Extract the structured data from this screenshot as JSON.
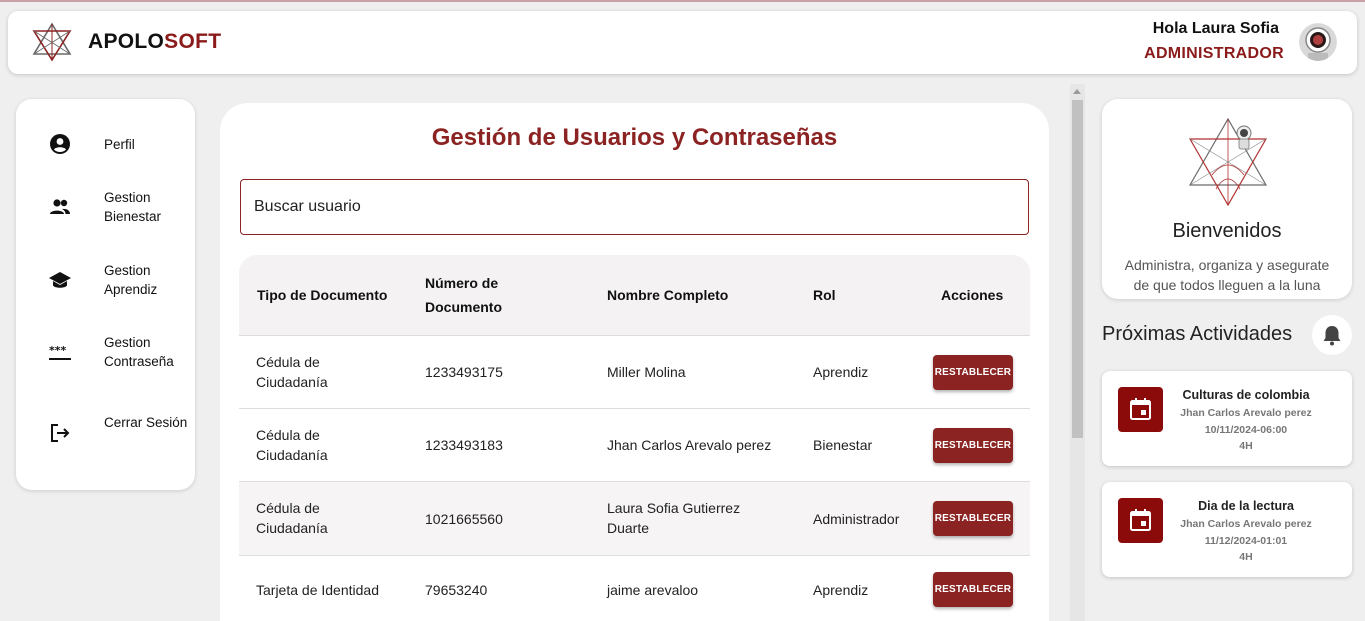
{
  "header": {
    "brand_part1": "APOLO",
    "brand_part2": "SOFT",
    "greeting": "Hola Laura Sofia",
    "role": "ADMINISTRADOR"
  },
  "sidebar": {
    "items": [
      {
        "label": "Perfil",
        "icon": "account-circle-icon"
      },
      {
        "label": "Gestion Bienestar",
        "icon": "group-icon"
      },
      {
        "label": "Gestion Aprendiz",
        "icon": "school-icon"
      },
      {
        "label": "Gestion Contraseña",
        "icon": "password-icon"
      },
      {
        "label": "Cerrar Sesión",
        "icon": "logout-icon"
      }
    ]
  },
  "main": {
    "title": "Gestión de Usuarios y Contraseñas",
    "search_placeholder": "Buscar usuario",
    "table": {
      "headers": [
        "Tipo de Documento",
        "Número de Documento",
        "Nombre Completo",
        "Rol",
        "Acciones"
      ],
      "rows": [
        {
          "tipo": "Cédula de Ciudadanía",
          "numero": "1233493175",
          "nombre": "Miller Molina",
          "rol": "Aprendiz",
          "accion": "RESTABLECER"
        },
        {
          "tipo": "Cédula de Ciudadanía",
          "numero": "1233493183",
          "nombre": "Jhan Carlos Arevalo perez",
          "rol": "Bienestar",
          "accion": "RESTABLECER"
        },
        {
          "tipo": "Cédula de Ciudadanía",
          "numero": "1021665560",
          "nombre": "Laura Sofia Gutierrez Duarte",
          "rol": "Administrador",
          "accion": "RESTABLECER"
        },
        {
          "tipo": "Tarjeta de Identidad",
          "numero": "79653240",
          "nombre": "jaime arevaloo",
          "rol": "Aprendiz",
          "accion": "RESTABLECER"
        }
      ]
    }
  },
  "welcome": {
    "title": "Bienvenidos",
    "text": "Administra, organiza y asegurate de que todos lleguen a la luna"
  },
  "activities": {
    "title": "Próximas Actividades",
    "items": [
      {
        "name": "Culturas de colombia",
        "author": "Jhan Carlos Arevalo perez",
        "date": "10/11/2024-06:00",
        "duration": "4H"
      },
      {
        "name": "Dia de la lectura",
        "author": "Jhan Carlos Arevalo perez",
        "date": "11/12/2024-01:01",
        "duration": "4H"
      }
    ]
  },
  "colors": {
    "accent": "#8b2323",
    "activity_icon_bg": "#8b0a0a",
    "background": "#efefef"
  }
}
